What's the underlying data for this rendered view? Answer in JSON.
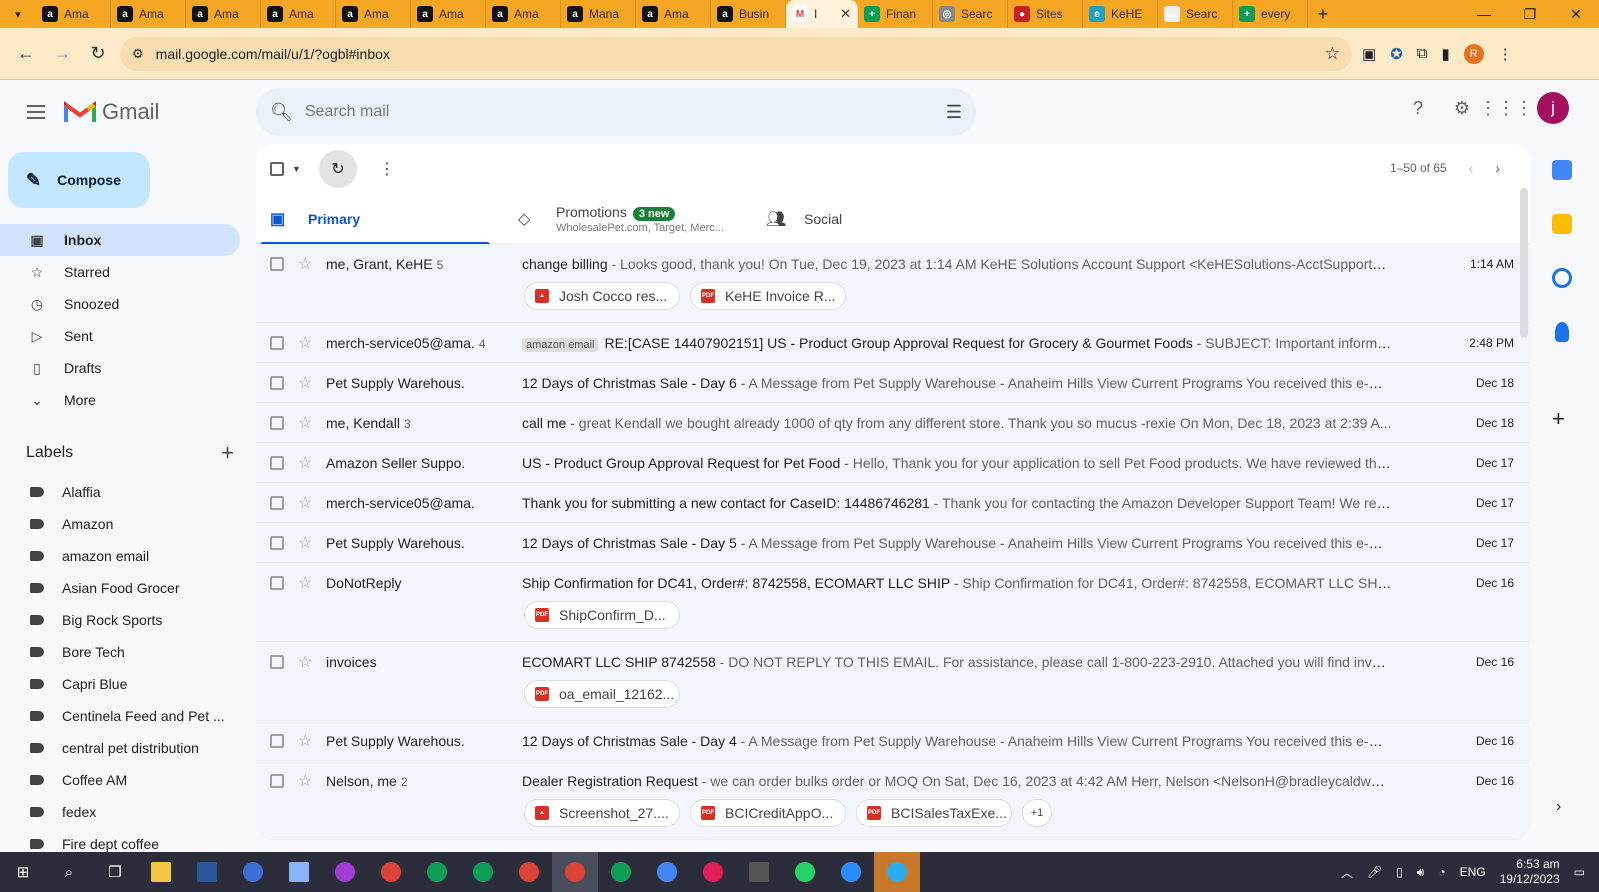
{
  "browser": {
    "tabs": [
      {
        "label": "Ama",
        "favicon": "amazon-icon"
      },
      {
        "label": "Ama",
        "favicon": "amazon-icon"
      },
      {
        "label": "Ama",
        "favicon": "amazon-icon"
      },
      {
        "label": "Ama",
        "favicon": "amazon-icon"
      },
      {
        "label": "Ama",
        "favicon": "amazon-icon"
      },
      {
        "label": "Ama",
        "favicon": "amazon-icon"
      },
      {
        "label": "Ama",
        "favicon": "amazon-icon"
      },
      {
        "label": "Mana",
        "favicon": "amazon-icon"
      },
      {
        "label": "Ama",
        "favicon": "amazon-icon"
      },
      {
        "label": "Busin",
        "favicon": "amazon-icon"
      },
      {
        "label": "I",
        "favicon": "gmail-icon",
        "active": true
      },
      {
        "label": "Finan",
        "favicon": "sheets-icon"
      },
      {
        "label": "Searc",
        "favicon": "globe-icon"
      },
      {
        "label": "Sites",
        "favicon": "sites-icon"
      },
      {
        "label": "KeHE",
        "favicon": "edge-icon"
      },
      {
        "label": "Searc",
        "favicon": "search-icon"
      },
      {
        "label": "every",
        "favicon": "sheets-icon"
      }
    ],
    "url": "mail.google.com/mail/u/1/?ogbl#inbox",
    "profile_initial": "R"
  },
  "gmail": {
    "brand": "Gmail",
    "search_placeholder": "Search mail",
    "avatar_initial": "j",
    "compose_label": "Compose",
    "nav": [
      {
        "label": "Inbox",
        "icon": "inbox-icon",
        "selected": true
      },
      {
        "label": "Starred",
        "icon": "star-icon"
      },
      {
        "label": "Snoozed",
        "icon": "clock-icon"
      },
      {
        "label": "Sent",
        "icon": "send-icon"
      },
      {
        "label": "Drafts",
        "icon": "draft-icon"
      },
      {
        "label": "More",
        "icon": "chevron-down-icon"
      }
    ],
    "labels_heading": "Labels",
    "labels": [
      "Alaffia",
      "Amazon",
      "amazon email",
      "Asian Food Grocer",
      "Big Rock Sports",
      "Bore Tech",
      "Capri Blue",
      "Centinela Feed and Pet ...",
      "central pet distribution",
      "Coffee AM",
      "fedex",
      "Fire dept coffee"
    ],
    "pager": "1–50 of 65",
    "tabs": {
      "primary": "Primary",
      "promotions": "Promotions",
      "promotions_badge": "3 new",
      "promotions_sub": "WholesalePet.com, Target, Merc...",
      "social": "Social"
    },
    "emails": [
      {
        "sender": "me, Grant, KeHE",
        "count": "5",
        "label": "",
        "subject": "change billing",
        "snippet": " - Looks good, thank you! On Tue, Dec 19, 2023 at 1:14 AM KeHE Solutions Account Support <KeHESolutions-AcctSupport@k...",
        "date": "1:14 AM",
        "attachments": [
          {
            "name": "Josh Cocco res...",
            "type": "image"
          },
          {
            "name": "KeHE Invoice R...",
            "type": "pdf"
          }
        ]
      },
      {
        "sender": "merch-service05@ama.",
        "count": "4",
        "label": "amazon email",
        "subject": "RE:[CASE 14407902151] US - Product Group Approval Request for Grocery & Gourmet Foods",
        "snippet": " - SUBJECT: Important informat...",
        "date": "2:48 PM",
        "attachments": []
      },
      {
        "sender": "Pet Supply Warehous.",
        "count": "",
        "label": "",
        "subject": "12 Days of Christmas Sale - Day 6",
        "snippet": " - A Message from Pet Supply Warehouse - Anaheim Hills View Current Programs You received this e-mai...",
        "date": "Dec 18",
        "attachments": []
      },
      {
        "sender": "me, Kendall",
        "count": "3",
        "label": "",
        "subject": "call me",
        "snippet": " - great Kendall we bought already 1000 of qty from any different store. Thank you so mucus -rexie On Mon, Dec 18, 2023 at 2:39 A...",
        "date": "Dec 18",
        "attachments": []
      },
      {
        "sender": "Amazon Seller Suppo.",
        "count": "",
        "label": "",
        "subject": "US - Product Group Approval Request for Pet Food",
        "snippet": " - Hello, Thank you for your application to sell Pet Food products. We have reviewed the...",
        "date": "Dec 17",
        "attachments": []
      },
      {
        "sender": "merch-service05@ama.",
        "count": "",
        "label": "",
        "subject": "Thank you for submitting a new contact for CaseID: 14486746281",
        "snippet": " - Thank you for contacting the Amazon Developer Support Team! We rec...",
        "date": "Dec 17",
        "attachments": []
      },
      {
        "sender": "Pet Supply Warehous.",
        "count": "",
        "label": "",
        "subject": "12 Days of Christmas Sale - Day 5",
        "snippet": " - A Message from Pet Supply Warehouse - Anaheim Hills View Current Programs You received this e-mail...",
        "date": "Dec 17",
        "attachments": []
      },
      {
        "sender": "DoNotReply",
        "count": "",
        "label": "",
        "subject": "Ship Confirmation for DC41, Order#: 8742558, ECOMART LLC SHIP",
        "snippet": " - Ship Confirmation for DC41, Order#: 8742558, ECOMART LLC SHIP Fr...",
        "date": "Dec 16",
        "attachments": [
          {
            "name": "ShipConfirm_D...",
            "type": "pdf"
          }
        ]
      },
      {
        "sender": "invoices",
        "count": "",
        "label": "",
        "subject": "ECOMART LLC SHIP 8742558",
        "snippet": " - DO NOT REPLY TO THIS EMAIL. For assistance, please call 1-800-223-2910. Attached you will find invoice #...",
        "date": "Dec 16",
        "attachments": [
          {
            "name": "oa_email_12162...",
            "type": "pdf"
          }
        ]
      },
      {
        "sender": "Pet Supply Warehous.",
        "count": "",
        "label": "",
        "subject": "12 Days of Christmas Sale - Day 4",
        "snippet": " - A Message from Pet Supply Warehouse - Anaheim Hills View Current Programs You received this e-mai...",
        "date": "Dec 16",
        "attachments": []
      },
      {
        "sender": "Nelson, me",
        "count": "2",
        "label": "",
        "subject": "Dealer Registration Request",
        "snippet": " - we can order bulks order or MOQ On Sat, Dec 16, 2023 at 4:42 AM Herr, Nelson <NelsonH@bradleycaldwell.c...",
        "date": "Dec 16",
        "attachments": [
          {
            "name": "Screenshot_27....",
            "type": "image"
          },
          {
            "name": "BCICreditAppO...",
            "type": "pdf"
          },
          {
            "name": "BCISalesTaxExe...",
            "type": "pdf"
          }
        ],
        "more": "+1"
      }
    ]
  },
  "taskbar": {
    "lang": "ENG",
    "time": "6:53 am",
    "date": "19/12/2023"
  },
  "colors": {
    "accent": "#0b57d0",
    "compose": "#c2e7ff",
    "selected_nav": "#d3e3fd",
    "tabbar": "#f5a623"
  }
}
